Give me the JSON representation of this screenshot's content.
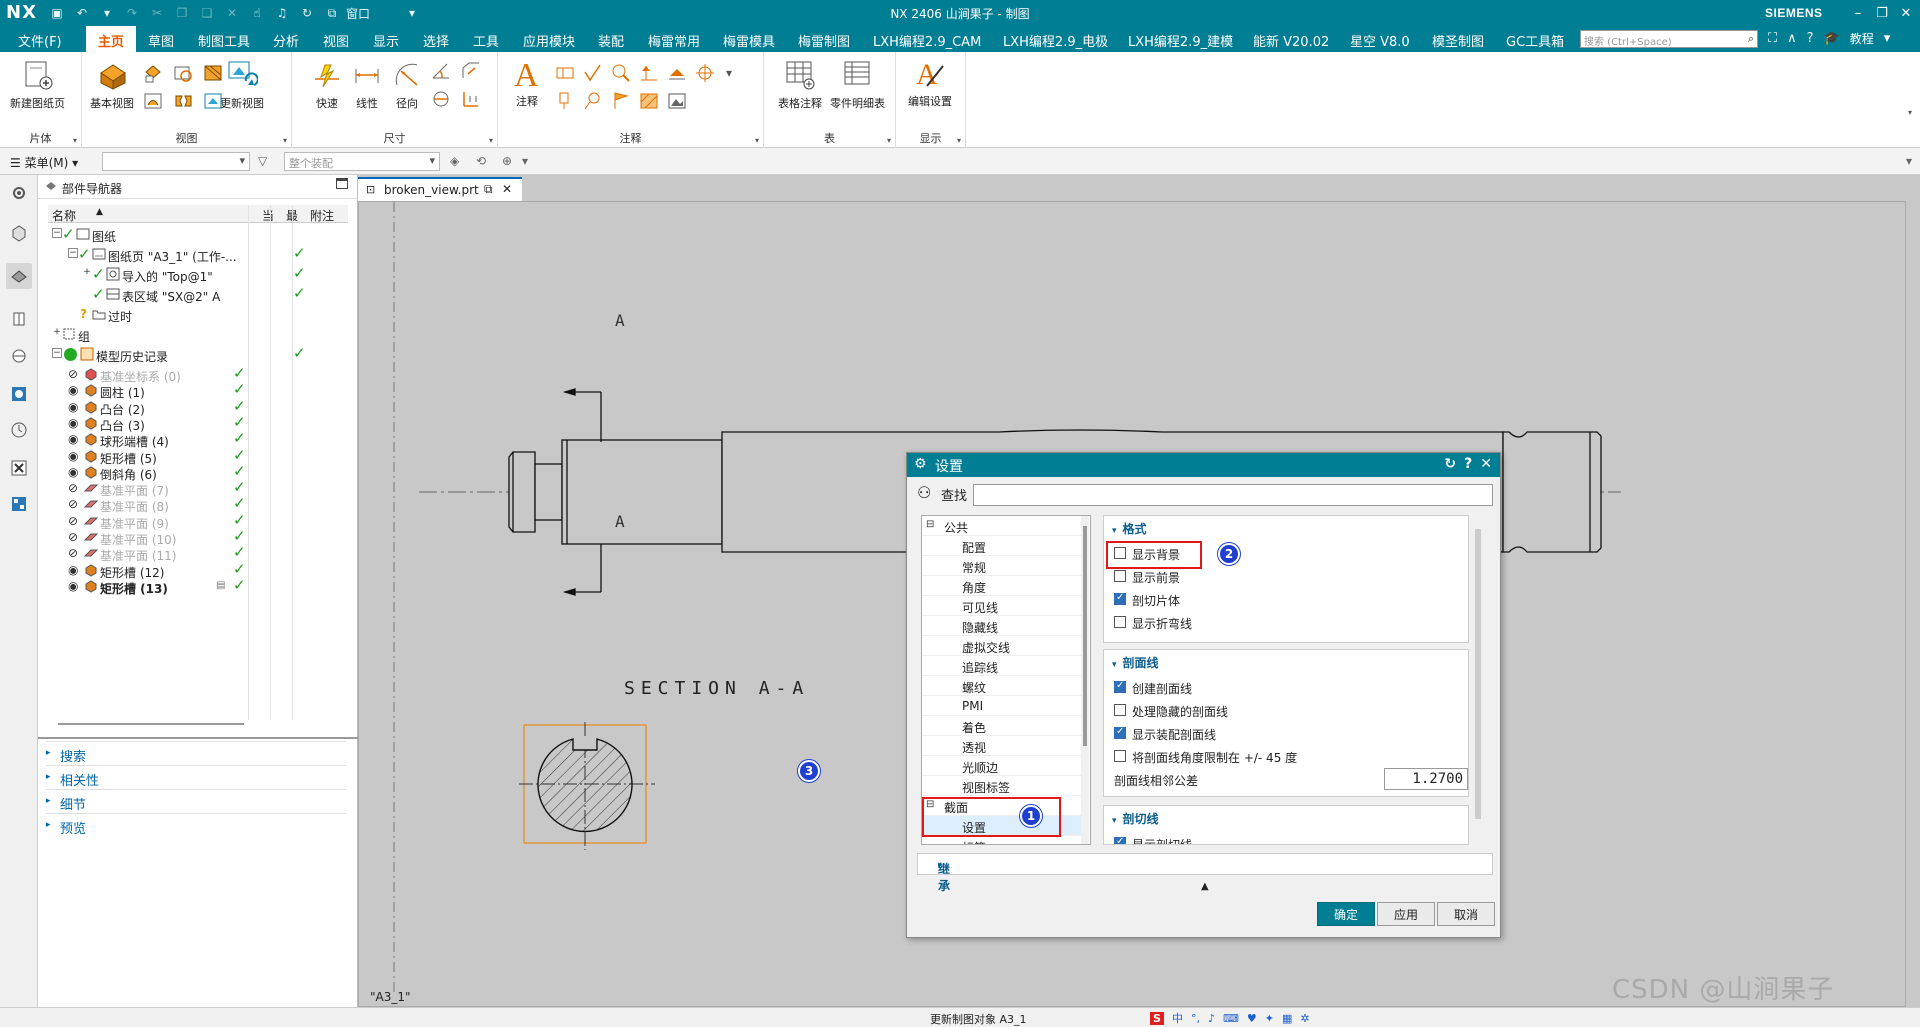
{
  "titlebar": {
    "logo": "NX",
    "title": "NX 2406 山涧果子 - 制图",
    "brand": "SIEMENS",
    "window_menu": "窗口"
  },
  "menu": {
    "file": "文件(F)",
    "items": [
      "主页",
      "草图",
      "制图工具",
      "分析",
      "视图",
      "显示",
      "选择",
      "工具",
      "应用模块",
      "装配",
      "梅雷常用",
      "梅雷模具",
      "梅雷制图",
      "LXH编程2.9_CAM",
      "LXH编程2.9_电极",
      "LXH编程2.9_建模",
      "能新 V20.02",
      "星空 V8.0",
      "模圣制图",
      "GC工具箱"
    ],
    "search_placeholder": "搜索 (Ctrl+Space)",
    "tutorial": "教程"
  },
  "ribbon": {
    "groups": [
      "片体",
      "视图",
      "尺寸",
      "注释",
      "表",
      "显示"
    ],
    "buttons": {
      "new_sheet": "新建图纸页",
      "base_view": "基本视图",
      "update_view": "更新视图",
      "rapid": "快速",
      "linear": "线性",
      "radial": "径向",
      "note": "注释",
      "table_note": "表格注释",
      "parts_list": "零件明细表",
      "edit_settings": "编辑设置"
    }
  },
  "toolbar2": {
    "menu": "菜单(M)",
    "filter_placeholder": "",
    "assembly_placeholder": "整个装配"
  },
  "navigator": {
    "title": "部件导航器",
    "columns": {
      "name": "名称",
      "current": "当",
      "latest": "最",
      "comment": "附注"
    },
    "rows": [
      {
        "label": "图纸"
      },
      {
        "label": "图纸页 \"A3_1\" (工作-..."
      },
      {
        "label": "导入的 \"Top@1\""
      },
      {
        "label": "表区域 \"SX@2\" A"
      },
      {
        "label": "过时"
      },
      {
        "label": "组"
      },
      {
        "label": "模型历史记录"
      },
      {
        "label": "基准坐标系 (0)"
      },
      {
        "label": "圆柱 (1)"
      },
      {
        "label": "凸台 (2)"
      },
      {
        "label": "凸台 (3)"
      },
      {
        "label": "球形端槽 (4)"
      },
      {
        "label": "矩形槽 (5)"
      },
      {
        "label": "倒斜角 (6)"
      },
      {
        "label": "基准平面 (7)"
      },
      {
        "label": "基准平面 (8)"
      },
      {
        "label": "基准平面 (9)"
      },
      {
        "label": "基准平面 (10)"
      },
      {
        "label": "基准平面 (11)"
      },
      {
        "label": "矩形槽 (12)"
      },
      {
        "label": "矩形槽 (13)"
      }
    ],
    "sections": [
      "搜索",
      "相关性",
      "细节",
      "预览"
    ]
  },
  "document": {
    "tab": "broken_view.prt",
    "sheet": "\"A3_1\""
  },
  "drawing": {
    "section_label": "SECTION A-A",
    "cut_label": "A"
  },
  "dialog": {
    "title": "设置",
    "find": "查找",
    "tree": {
      "common": "公共",
      "common_items": [
        "配置",
        "常规",
        "角度",
        "可见线",
        "隐藏线",
        "虚拟交线",
        "追踪线",
        "螺纹",
        "PMI",
        "着色",
        "透视",
        "光顺边",
        "视图标签"
      ],
      "section": "截面",
      "section_items": [
        "设置",
        "标签"
      ]
    },
    "format": {
      "header": "格式",
      "show_background": "显示背景",
      "show_foreground": "显示前景",
      "cut_body": "剖切片体",
      "show_bend_lines": "显示折弯线"
    },
    "hatch": {
      "header": "剖面线",
      "create_hatch": "创建剖面线",
      "hidden_hatch": "处理隐藏的剖面线",
      "assembly_hatch": "显示装配剖面线",
      "limit_angle": "将剖面线角度限制在 +/- 45 度",
      "tolerance_label": "剖面线相邻公差",
      "tolerance_value": "1.2700"
    },
    "cut_line": {
      "header": "剖切线",
      "show": "显示剖切线"
    },
    "inherit": "继承",
    "buttons": {
      "ok": "确定",
      "apply": "应用",
      "cancel": "取消"
    }
  },
  "callouts": [
    "1",
    "2",
    "3"
  ],
  "status": {
    "text": "更新制图对象 A3_1"
  },
  "watermark": "CSDN @山涧果子",
  "colors": {
    "title_bg": "#007e94",
    "accent": "#e35c00",
    "canvas": "#c8c8c8"
  }
}
